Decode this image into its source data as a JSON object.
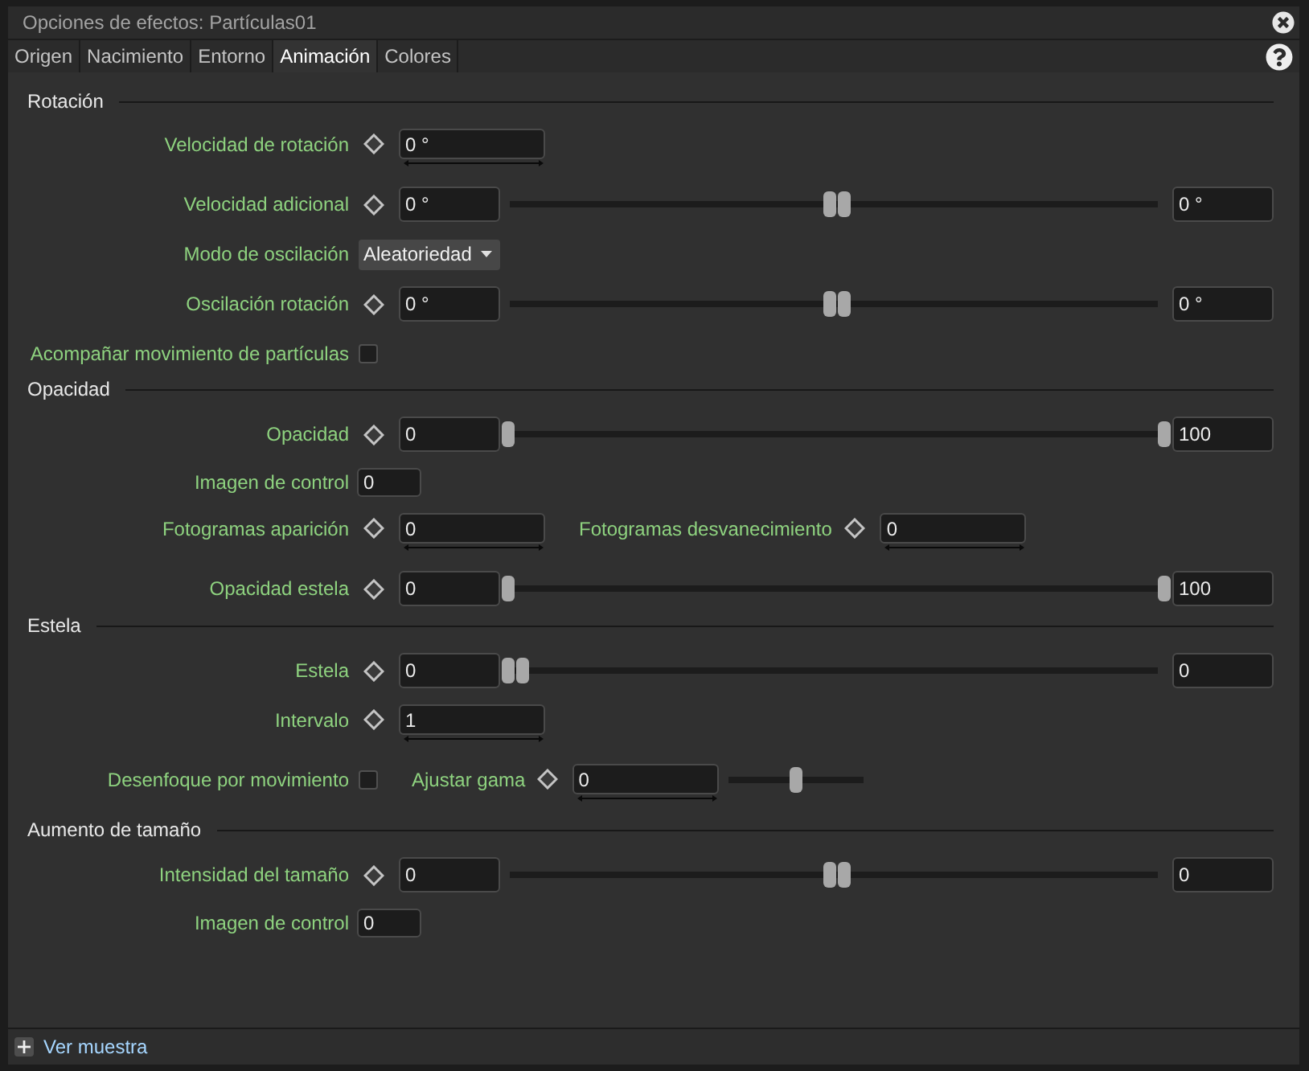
{
  "window": {
    "title": "Opciones de efectos: Partículas01"
  },
  "tabs": [
    {
      "label": "Origen",
      "selected": false
    },
    {
      "label": "Nacimiento",
      "selected": false
    },
    {
      "label": "Entorno",
      "selected": false
    },
    {
      "label": "Animación",
      "selected": true
    },
    {
      "label": "Colores",
      "selected": false
    }
  ],
  "sections": [
    {
      "title": "Rotación",
      "rows": [
        {
          "kind": "spin",
          "label": "Velocidad de rotación",
          "value": "0 °"
        },
        {
          "kind": "range",
          "label": "Velocidad adicional",
          "value": "0 °",
          "thumbs": [
            {
              "level": 0.5
            },
            {
              "level": 0.5
            }
          ],
          "end_value": "0 °"
        },
        {
          "kind": "dropdown",
          "label": "Modo de oscilación",
          "value": "Aleatoriedad"
        },
        {
          "kind": "range",
          "label": "Oscilación rotación",
          "value": "0 °",
          "thumbs": [
            {
              "level": 0.5
            },
            {
              "level": 0.5
            }
          ],
          "end_value": "0 °"
        },
        {
          "kind": "checkbox",
          "label": "Acompañar movimiento de partículas",
          "checked": false
        }
      ]
    },
    {
      "title": "Opacidad",
      "rows": [
        {
          "kind": "range",
          "label": "Opacidad",
          "value": "0",
          "thumbs": [
            {
              "level": 0
            },
            {
              "level": 1
            }
          ],
          "end_value": "100"
        },
        {
          "kind": "number",
          "label": "Imagen de control",
          "value": "0"
        },
        {
          "kind": "pair",
          "items": [
            {
              "label": "Fotogramas aparición",
              "value": "0"
            },
            {
              "label": "Fotogramas desvanecimiento",
              "value": "0"
            }
          ]
        },
        {
          "kind": "range",
          "label": "Opacidad estela",
          "value": "0",
          "thumbs": [
            {
              "level": 0
            },
            {
              "level": 1
            }
          ],
          "end_value": "100"
        }
      ]
    },
    {
      "title": "Estela",
      "rows": [
        {
          "kind": "range",
          "label": "Estela",
          "value": "0",
          "thumbs": [
            {
              "level": 0
            },
            {
              "level": 0
            }
          ],
          "end_value": "0"
        },
        {
          "kind": "spin",
          "label": "Intervalo",
          "value": "1"
        },
        {
          "kind": "combo",
          "label": "Desenfoque por movimiento",
          "checked": false,
          "gamma": {
            "label": "Ajustar gama",
            "value": "0",
            "level": 0.5
          }
        }
      ]
    },
    {
      "title": "Aumento de tamaño",
      "rows": [
        {
          "kind": "range",
          "label": "Intensidad del tamaño",
          "value": "0",
          "thumbs": [
            {
              "level": 0.5
            },
            {
              "level": 0.5
            }
          ],
          "end_value": "0"
        },
        {
          "kind": "number",
          "label": "Imagen de control",
          "value": "0"
        }
      ]
    }
  ],
  "footer": {
    "label": "Ver muestra",
    "expanded": false
  }
}
